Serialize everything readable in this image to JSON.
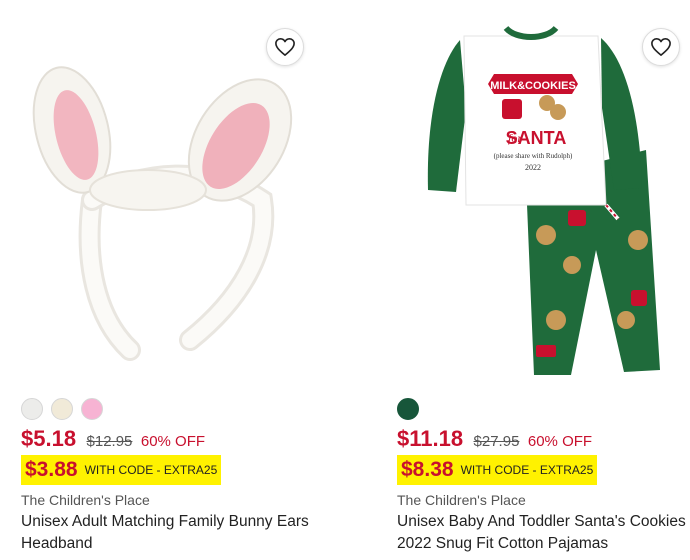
{
  "products": [
    {
      "name": "Unisex Adult Matching Family Bunny Ears Headband",
      "brand": "The Children's Place",
      "sale_price": "$5.18",
      "original_price": "$12.95",
      "discount": "60% OFF",
      "promo_price": "$3.88",
      "promo_code_text": "WITH CODE - EXTRA25",
      "swatches": [
        "#ececea",
        "#f1ead8",
        "#f7b3d3"
      ],
      "image_icon": "bunny-ears-headband-image"
    },
    {
      "name": "Unisex Baby And Toddler Santa's Cookies 2022 Snug Fit Cotton Pajamas",
      "brand": "The Children's Place",
      "sale_price": "$11.18",
      "original_price": "$27.95",
      "discount": "60% OFF",
      "promo_price": "$8.38",
      "promo_code_text": "WITH CODE - EXTRA25",
      "swatches": [
        "#17563a"
      ],
      "image_icon": "santa-pajamas-image",
      "image_text": {
        "banner": "MILK&COOKIES",
        "for": "for",
        "santa": "SANTA",
        "sub": "(please share with Rudolph)",
        "year": "2022"
      }
    }
  ],
  "colors": {
    "sale_red": "#c8102e",
    "promo_yellow": "#fff200",
    "pajama_green": "#1f6b3b"
  }
}
